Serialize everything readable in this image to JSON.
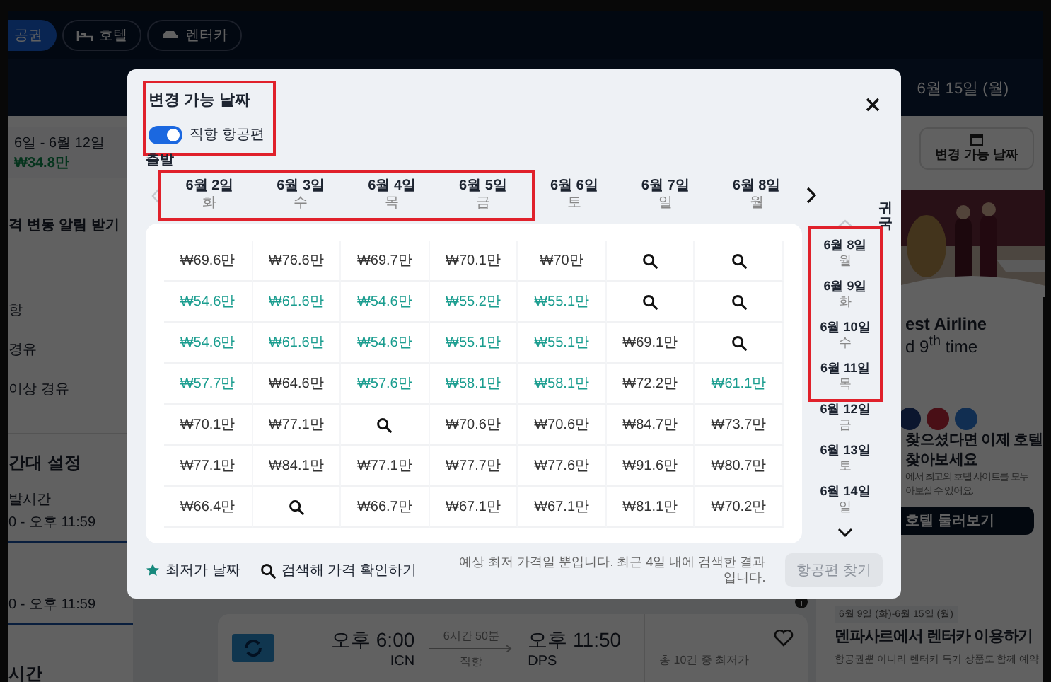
{
  "background_page": {
    "nav_tabs": [
      {
        "label": "공권",
        "selected": true
      },
      {
        "label": "호텔",
        "selected": false
      },
      {
        "label": "렌터카",
        "selected": false
      }
    ],
    "date_nav": {
      "label": "6월 15일 (월)"
    },
    "left_panel": {
      "trip_dates": "6일 - 6월 12일",
      "trip_price": "₩34.8만",
      "alert_label": "격 변동 알림 받기",
      "stops": [
        "항",
        "경유",
        "이상 경유"
      ],
      "time_title": "간대 설정",
      "departure_label": "발시간",
      "ranges": [
        "0 - 오후 11:59",
        "0 - 오후 11:59"
      ],
      "duration_title": "시간"
    },
    "flight": {
      "depart_time": "오후 6:00",
      "depart_code": "ICN",
      "duration": "6시간 50분",
      "stops": "직항",
      "arrive_time": "오후 11:50",
      "arrive_code": "DPS",
      "fare_note": "총 10건 중 최저가"
    },
    "right_panel": {
      "change_dates_button": "변경 가능 날짜",
      "ad_line1": "est Airline",
      "ad_line2": "d 9$^{th}$ time",
      "hotel_title": [
        "찾으셨다면 이제 호텔",
        "찾아보세요"
      ],
      "hotel_desc": [
        "에서 최고의 호텔 사이트를 모두",
        "아보실 수 있어요."
      ],
      "hotel_button": "호텔 둘러보기",
      "car_dates": "6월 9일 (화)-6월 15일 (월)",
      "car_title": "덴파사르에서 렌터카 이용하기",
      "car_desc": "항공권뿐 아니라 렌터카 특가 상품도 함께 예약"
    }
  },
  "modal": {
    "title": "변경 가능 날짜",
    "header_highlighted": true,
    "direct_toggle": {
      "label": "직항 항공편",
      "on": true
    },
    "departure_label": "출발",
    "return_label": "귀국",
    "departure_dates": [
      {
        "date": "6월 2일",
        "weekday": "화",
        "highlighted": true
      },
      {
        "date": "6월 3일",
        "weekday": "수",
        "highlighted": true
      },
      {
        "date": "6월 4일",
        "weekday": "목",
        "highlighted": true
      },
      {
        "date": "6월 5일",
        "weekday": "금",
        "highlighted": true
      },
      {
        "date": "6월 6일",
        "weekday": "토",
        "highlighted": false
      },
      {
        "date": "6월 7일",
        "weekday": "일",
        "highlighted": false
      },
      {
        "date": "6월 8일",
        "weekday": "월",
        "highlighted": false
      }
    ],
    "return_dates": [
      {
        "date": "6월 8일",
        "weekday": "월",
        "highlighted": true
      },
      {
        "date": "6월 9일",
        "weekday": "화",
        "highlighted": true
      },
      {
        "date": "6월 10일",
        "weekday": "수",
        "highlighted": true
      },
      {
        "date": "6월 11일",
        "weekday": "목",
        "highlighted": true
      },
      {
        "date": "6월 12일",
        "weekday": "금",
        "highlighted": false
      },
      {
        "date": "6월 13일",
        "weekday": "토",
        "highlighted": false
      },
      {
        "date": "6월 14일",
        "weekday": "일",
        "highlighted": false
      }
    ],
    "rows": [
      [
        {
          "kind": "price",
          "text": "₩69.6만",
          "cheap": false
        },
        {
          "kind": "price",
          "text": "₩76.6만",
          "cheap": false
        },
        {
          "kind": "price",
          "text": "₩69.7만",
          "cheap": false
        },
        {
          "kind": "price",
          "text": "₩70.1만",
          "cheap": false
        },
        {
          "kind": "price",
          "text": "₩70만",
          "cheap": false
        },
        {
          "kind": "search"
        },
        {
          "kind": "search"
        }
      ],
      [
        {
          "kind": "price",
          "text": "₩54.6만",
          "cheap": true
        },
        {
          "kind": "price",
          "text": "₩61.6만",
          "cheap": true
        },
        {
          "kind": "price",
          "text": "₩54.6만",
          "cheap": true
        },
        {
          "kind": "price",
          "text": "₩55.2만",
          "cheap": true
        },
        {
          "kind": "price",
          "text": "₩55.1만",
          "cheap": true
        },
        {
          "kind": "search"
        },
        {
          "kind": "search"
        }
      ],
      [
        {
          "kind": "price",
          "text": "₩54.6만",
          "cheap": true
        },
        {
          "kind": "price",
          "text": "₩61.6만",
          "cheap": true
        },
        {
          "kind": "price",
          "text": "₩54.6만",
          "cheap": true
        },
        {
          "kind": "price",
          "text": "₩55.1만",
          "cheap": true
        },
        {
          "kind": "price",
          "text": "₩55.1만",
          "cheap": true
        },
        {
          "kind": "price",
          "text": "₩69.1만",
          "cheap": false
        },
        {
          "kind": "search"
        }
      ],
      [
        {
          "kind": "price",
          "text": "₩57.7만",
          "cheap": true
        },
        {
          "kind": "price",
          "text": "₩64.6만",
          "cheap": false
        },
        {
          "kind": "price",
          "text": "₩57.6만",
          "cheap": true
        },
        {
          "kind": "price",
          "text": "₩58.1만",
          "cheap": true
        },
        {
          "kind": "price",
          "text": "₩58.1만",
          "cheap": true
        },
        {
          "kind": "price",
          "text": "₩72.2만",
          "cheap": false
        },
        {
          "kind": "price",
          "text": "₩61.1만",
          "cheap": true
        }
      ],
      [
        {
          "kind": "price",
          "text": "₩70.1만",
          "cheap": false
        },
        {
          "kind": "price",
          "text": "₩77.1만",
          "cheap": false
        },
        {
          "kind": "search"
        },
        {
          "kind": "price",
          "text": "₩70.6만",
          "cheap": false
        },
        {
          "kind": "price",
          "text": "₩70.6만",
          "cheap": false
        },
        {
          "kind": "price",
          "text": "₩84.7만",
          "cheap": false
        },
        {
          "kind": "price",
          "text": "₩73.7만",
          "cheap": false
        }
      ],
      [
        {
          "kind": "price",
          "text": "₩77.1만",
          "cheap": false
        },
        {
          "kind": "price",
          "text": "₩84.1만",
          "cheap": false
        },
        {
          "kind": "price",
          "text": "₩77.1만",
          "cheap": false
        },
        {
          "kind": "price",
          "text": "₩77.7만",
          "cheap": false
        },
        {
          "kind": "price",
          "text": "₩77.6만",
          "cheap": false
        },
        {
          "kind": "price",
          "text": "₩91.6만",
          "cheap": false
        },
        {
          "kind": "price",
          "text": "₩80.7만",
          "cheap": false
        }
      ],
      [
        {
          "kind": "price",
          "text": "₩66.4만",
          "cheap": false
        },
        {
          "kind": "search"
        },
        {
          "kind": "price",
          "text": "₩66.7만",
          "cheap": false
        },
        {
          "kind": "price",
          "text": "₩67.1만",
          "cheap": false
        },
        {
          "kind": "price",
          "text": "₩67.1만",
          "cheap": false
        },
        {
          "kind": "price",
          "text": "₩81.1만",
          "cheap": false
        },
        {
          "kind": "price",
          "text": "₩70.2만",
          "cheap": false
        }
      ]
    ],
    "legend": [
      {
        "kind": "star",
        "label": "최저가 날짜"
      },
      {
        "kind": "search",
        "label": "검색해 가격 확인하기"
      }
    ],
    "note": "예상 최저 가격일 뿐입니다. 최근 4일 내에 검색한 결과입니다.",
    "search_button": {
      "label": "항공편 찾기",
      "disabled": true
    }
  }
}
